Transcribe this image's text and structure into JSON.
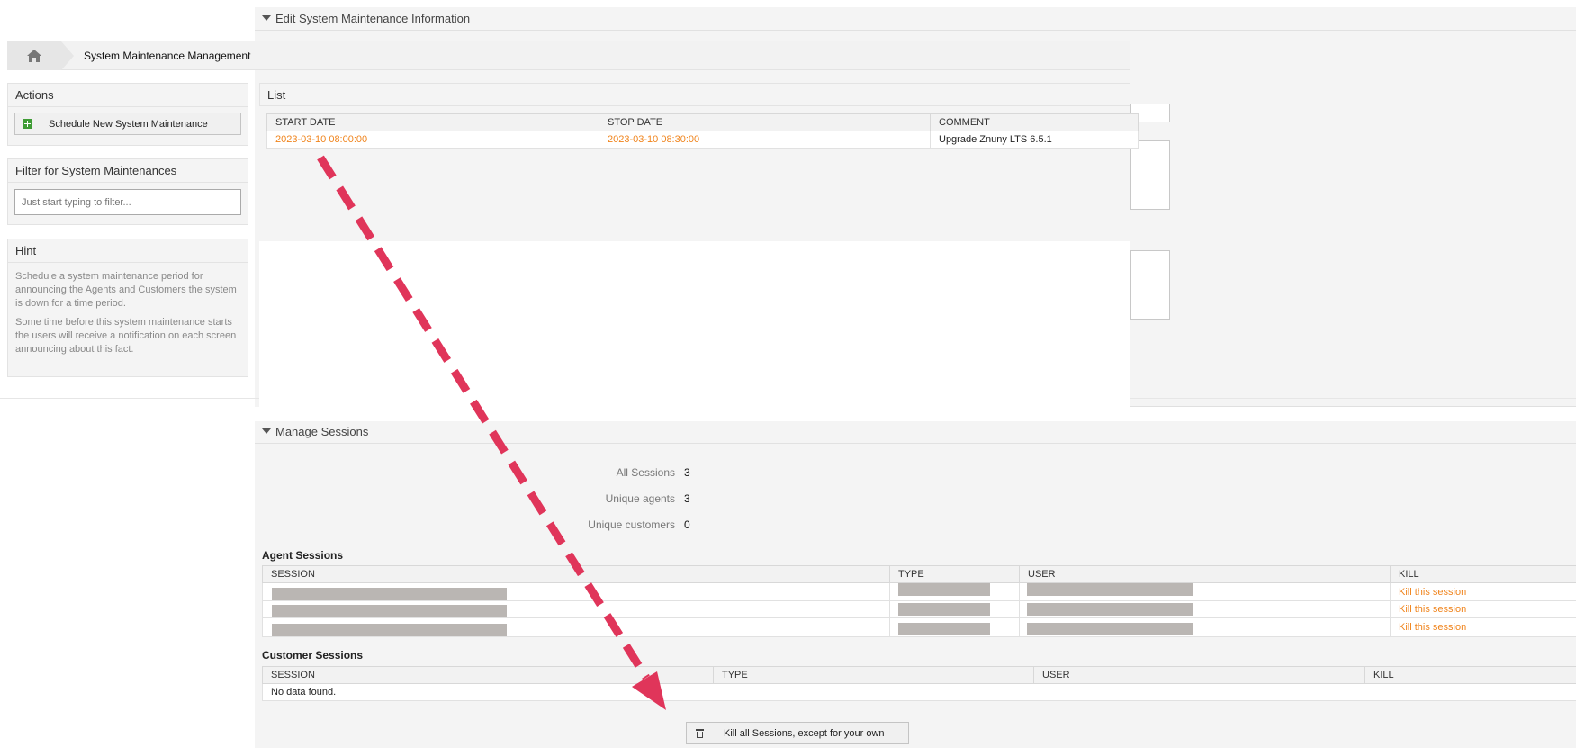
{
  "edit_panel": {
    "title": "Edit System Maintenance Information"
  },
  "breadcrumb": {
    "home_icon": "home-icon",
    "current": "System Maintenance Management"
  },
  "sidebar": {
    "actions": {
      "title": "Actions",
      "button_label": "Schedule New System Maintenance",
      "button_icon": "plus-square-icon"
    },
    "filter": {
      "title": "Filter for System Maintenances",
      "placeholder": "Just start typing to filter..."
    },
    "hint": {
      "title": "Hint",
      "paragraphs": [
        "Schedule a system maintenance period for announcing the Agents and Customers the system is down for a time period.",
        "Some time before this system maintenance starts the users will receive a notification on each screen announcing about this fact."
      ]
    }
  },
  "list": {
    "title": "List",
    "columns": [
      "START DATE",
      "STOP DATE",
      "COMMENT"
    ],
    "rows": [
      {
        "start": "2023-03-10 08:00:00",
        "stop": "2023-03-10 08:30:00",
        "comment": "Upgrade Znuny LTS 6.5.1"
      }
    ]
  },
  "sessions": {
    "title": "Manage Sessions",
    "stats": [
      {
        "label": "All Sessions",
        "value": "3"
      },
      {
        "label": "Unique agents",
        "value": "3"
      },
      {
        "label": "Unique customers",
        "value": "0"
      }
    ],
    "agent_sessions": {
      "title": "Agent Sessions",
      "columns": [
        "SESSION",
        "TYPE",
        "USER",
        "KILL"
      ],
      "kill_label": "Kill this session",
      "row_count": 3
    },
    "customer_sessions": {
      "title": "Customer Sessions",
      "columns": [
        "SESSION",
        "TYPE",
        "USER",
        "KILL"
      ],
      "empty_text": "No data found."
    },
    "kill_all_label": "Kill all Sessions, except for your own",
    "kill_all_icon": "trash-icon"
  },
  "colors": {
    "link_orange": "#f0841c",
    "panel_gray": "#f4f4f4",
    "arrow_red": "#e0355a",
    "redaction_gray": "#bab6b3",
    "plus_green": "#3f9c35"
  }
}
